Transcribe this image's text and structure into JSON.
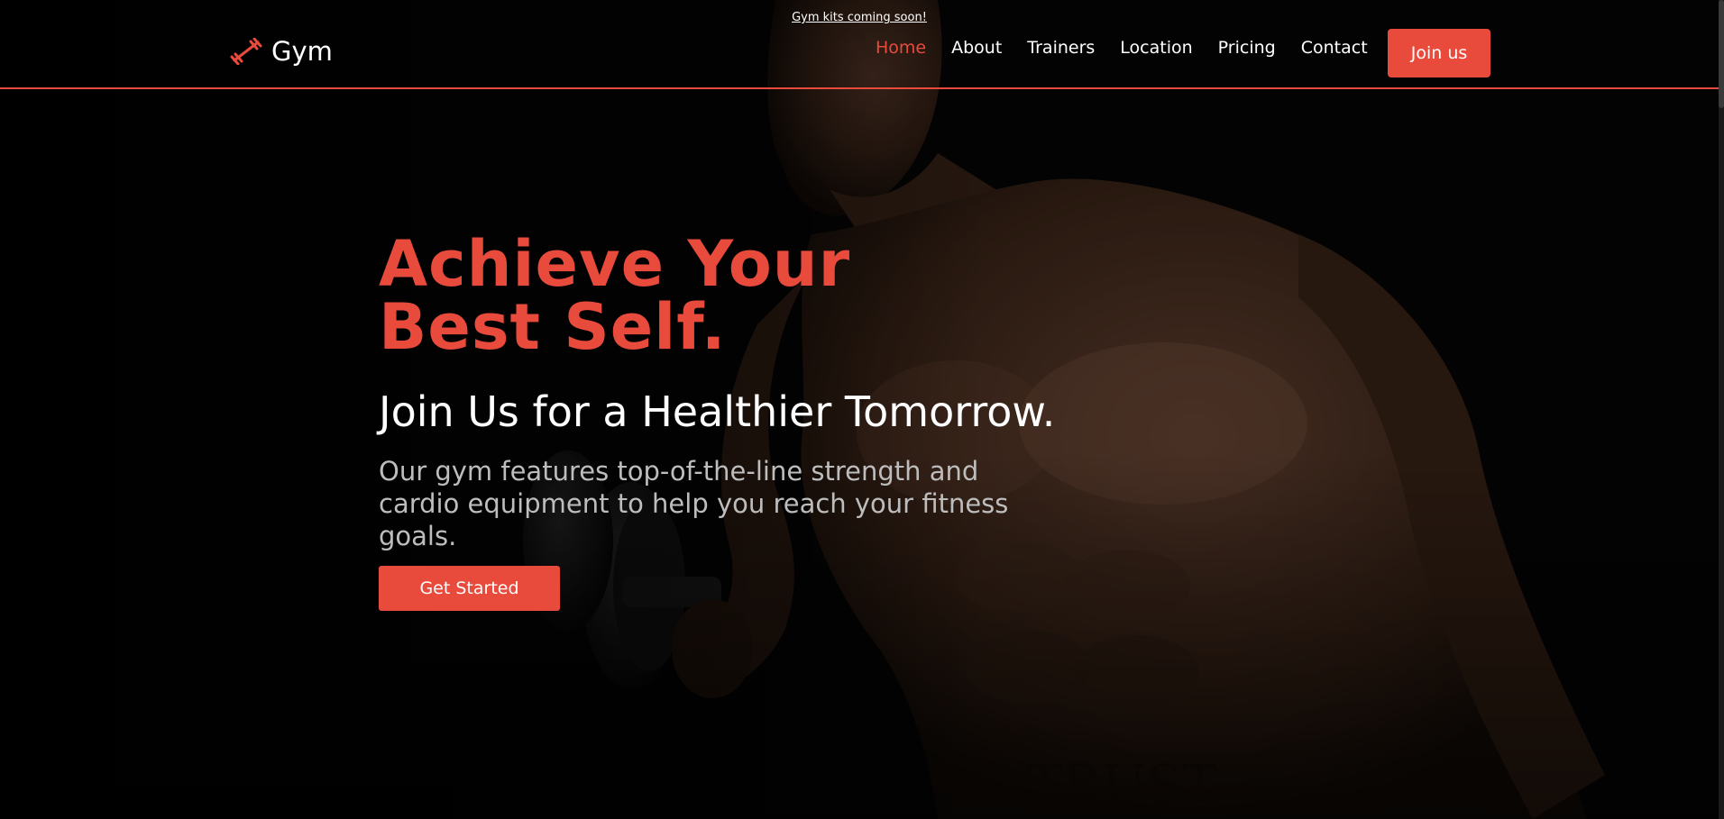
{
  "announcement": "Gym kits coming soon!",
  "logo": {
    "icon": "dumbbell-icon",
    "text": "Gym"
  },
  "nav": {
    "items": [
      {
        "label": "Home",
        "active": true
      },
      {
        "label": "About",
        "active": false
      },
      {
        "label": "Trainers",
        "active": false
      },
      {
        "label": "Location",
        "active": false
      },
      {
        "label": "Pricing",
        "active": false
      },
      {
        "label": "Contact",
        "active": false
      }
    ],
    "join_label": "Join us"
  },
  "hero": {
    "title": "Achieve Your Best Self.",
    "subtitle": "Join Us for a Healthier Tomorrow.",
    "description": "Our gym features top-of-the-line strength and cardio equipment to help you reach your fitness goals.",
    "cta_label": "Get Started"
  },
  "colors": {
    "accent": "#e84a3c",
    "background": "#060606",
    "text": "#ffffff",
    "muted_text": "#bdbdbd"
  }
}
